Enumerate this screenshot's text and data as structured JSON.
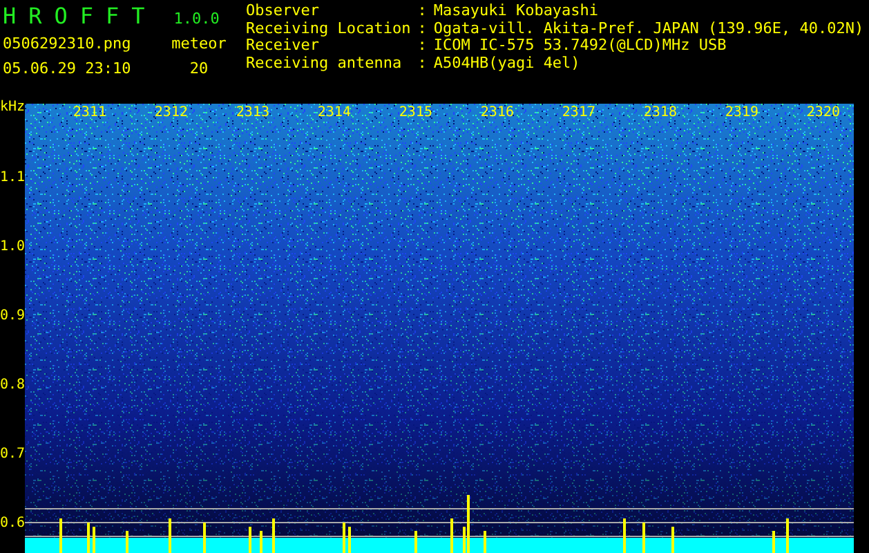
{
  "app": {
    "name": "HROFFT",
    "version": "1.0.0"
  },
  "file": {
    "name": "0506292310.png",
    "datetime": "05.06.29 23:10"
  },
  "meteor": {
    "label": "meteor",
    "count": "20"
  },
  "info": [
    {
      "label": "Observer",
      "separator": ":",
      "value": "Masayuki Kobayashi"
    },
    {
      "label": "Receiving Location",
      "separator": ":",
      "value": "Ogata-vill. Akita-Pref. JAPAN (139.96E, 40.02N)"
    },
    {
      "label": "Receiver",
      "separator": ":",
      "value": "ICOM IC-575 53.7492(@LCD)MHz USB"
    },
    {
      "label": "Receiving antenna",
      "separator": ":",
      "value": "A504HB(yagi 4el)"
    }
  ],
  "spectrogram": {
    "y_unit": "kHz",
    "y_labels": [
      "1.1",
      "1.0",
      "0.9",
      "0.8",
      "0.7",
      "0.6"
    ],
    "time_labels": [
      "2311",
      "2312",
      "2313",
      "2314",
      "2315",
      "2316",
      "2317",
      "2318",
      "2319",
      "2320"
    ]
  }
}
